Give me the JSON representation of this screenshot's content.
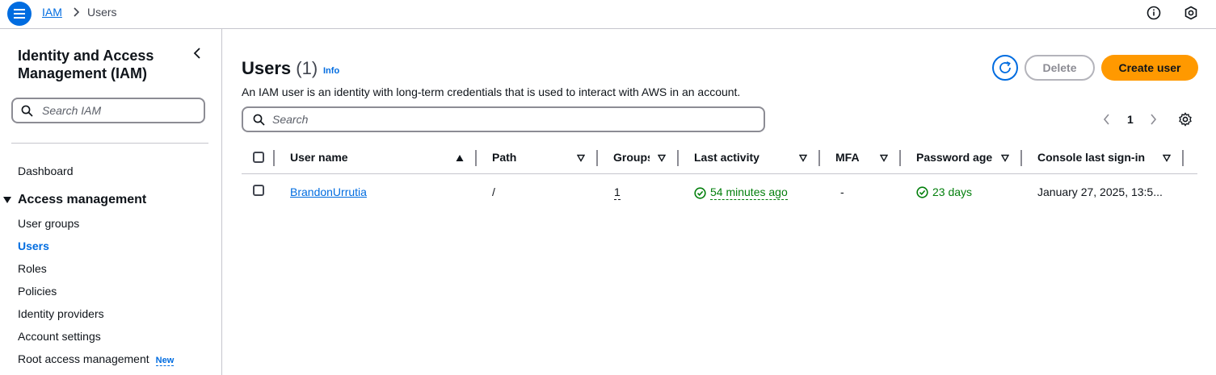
{
  "topbar": {
    "breadcrumb_service": "IAM",
    "breadcrumb_current": "Users"
  },
  "sidebar": {
    "title": "Identity and Access Management (IAM)",
    "search_placeholder": "Search IAM",
    "dashboard": "Dashboard",
    "section_access": "Access management",
    "items": [
      {
        "label": "User groups",
        "active": false
      },
      {
        "label": "Users",
        "active": true
      },
      {
        "label": "Roles",
        "active": false
      },
      {
        "label": "Policies",
        "active": false
      },
      {
        "label": "Identity providers",
        "active": false
      },
      {
        "label": "Account settings",
        "active": false
      },
      {
        "label": "Root access management",
        "active": false
      }
    ],
    "new_badge": "New"
  },
  "main": {
    "title": "Users",
    "count": "(1)",
    "info": "Info",
    "description": "An IAM user is an identity with long-term credentials that is used to interact with AWS in an account.",
    "delete_label": "Delete",
    "create_label": "Create user",
    "search_placeholder": "Search",
    "page_number": "1"
  },
  "table": {
    "columns": [
      "User name",
      "Path",
      "Groups",
      "Last activity",
      "MFA",
      "Password age",
      "Console last sign-in"
    ],
    "rows": [
      {
        "user_name": "BrandonUrrutia",
        "path": "/",
        "groups": "1",
        "last_activity": "54 minutes ago",
        "mfa": "-",
        "password_age": "23 days",
        "console_last_sign_in": "January 27, 2025, 13:5..."
      }
    ]
  },
  "colors": {
    "accent": "#006ce0",
    "primary_button": "#ff9900",
    "success": "#037f0c"
  }
}
